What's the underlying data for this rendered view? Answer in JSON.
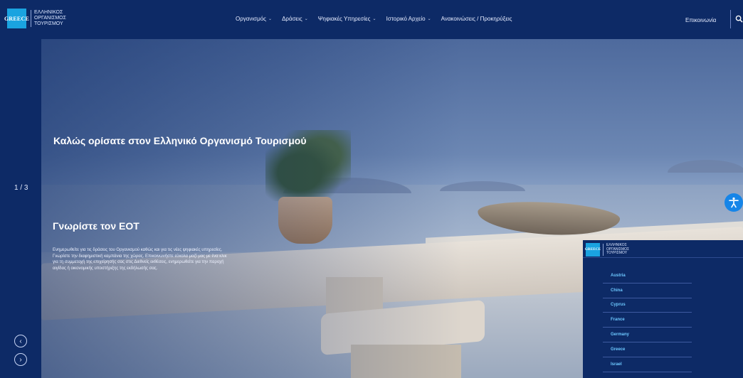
{
  "header": {
    "logo": {
      "badge": "GREECE",
      "lines": [
        "ΕΛΛΗΝΙΚΟΣ",
        "ΟΡΓΑΝΙΣΜΟΣ",
        "ΤΟΥΡΙΣΜΟΥ"
      ]
    },
    "nav": [
      {
        "label": "Οργανισμός",
        "dropdown": true
      },
      {
        "label": "Δράσεις",
        "dropdown": true
      },
      {
        "label": "Ψηφιακές Υπηρεσίες",
        "dropdown": true
      },
      {
        "label": "Ιστορικό Αρχείο",
        "dropdown": true
      },
      {
        "label": "Ανακοινώσεις / Προκηρύξεις",
        "dropdown": false
      }
    ],
    "contact": "Επικοινωνία",
    "search_icon": "search-icon"
  },
  "slider": {
    "counter": "1 / 3",
    "prev_icon": "chevron-left-icon",
    "next_icon": "chevron-right-icon"
  },
  "hero": {
    "welcome": "Καλώς ορίσατε στον Ελληνικό Οργανισμό Τουρισμού",
    "about_title": "Γνωρίστε τον ΕΟΤ",
    "about_text": "Ενημερωθείτε για τις δράσεις του Οργανισμού καθώς και για τις νέες ψηφιακές υπηρεσίες. Γνωρίστε την διαφημιστική καμπάνια της χώρας. Επικοινωνήστε εύκολα μαζί μας με ένα κλικ για τη συμμετοχή της επιχείρησής σας στις Διεθνείς εκθέσεις, ενημερωθείτε για την παροχή αιγίδας ή οικονομικής υποστήριξης της εκδήλωσής σας."
  },
  "accessibility": {
    "icon": "accessibility-icon",
    "color": "#1685e8"
  },
  "countries_panel": {
    "logo": {
      "badge": "GREECE",
      "lines": [
        "ΕΛΛΗΝΙΚΟΣ",
        "ΟΡΓΑΝΙΣΜΟΣ",
        "ΤΟΥΡΙΣΜΟΥ"
      ]
    },
    "countries": [
      "Austria",
      "China",
      "Cyprus",
      "France",
      "Germany",
      "Greece",
      "Israel"
    ]
  },
  "colors": {
    "brand_navy": "#0d2a66",
    "logo_blue": "#1aa3e0",
    "country_link": "#6dc8ff"
  }
}
